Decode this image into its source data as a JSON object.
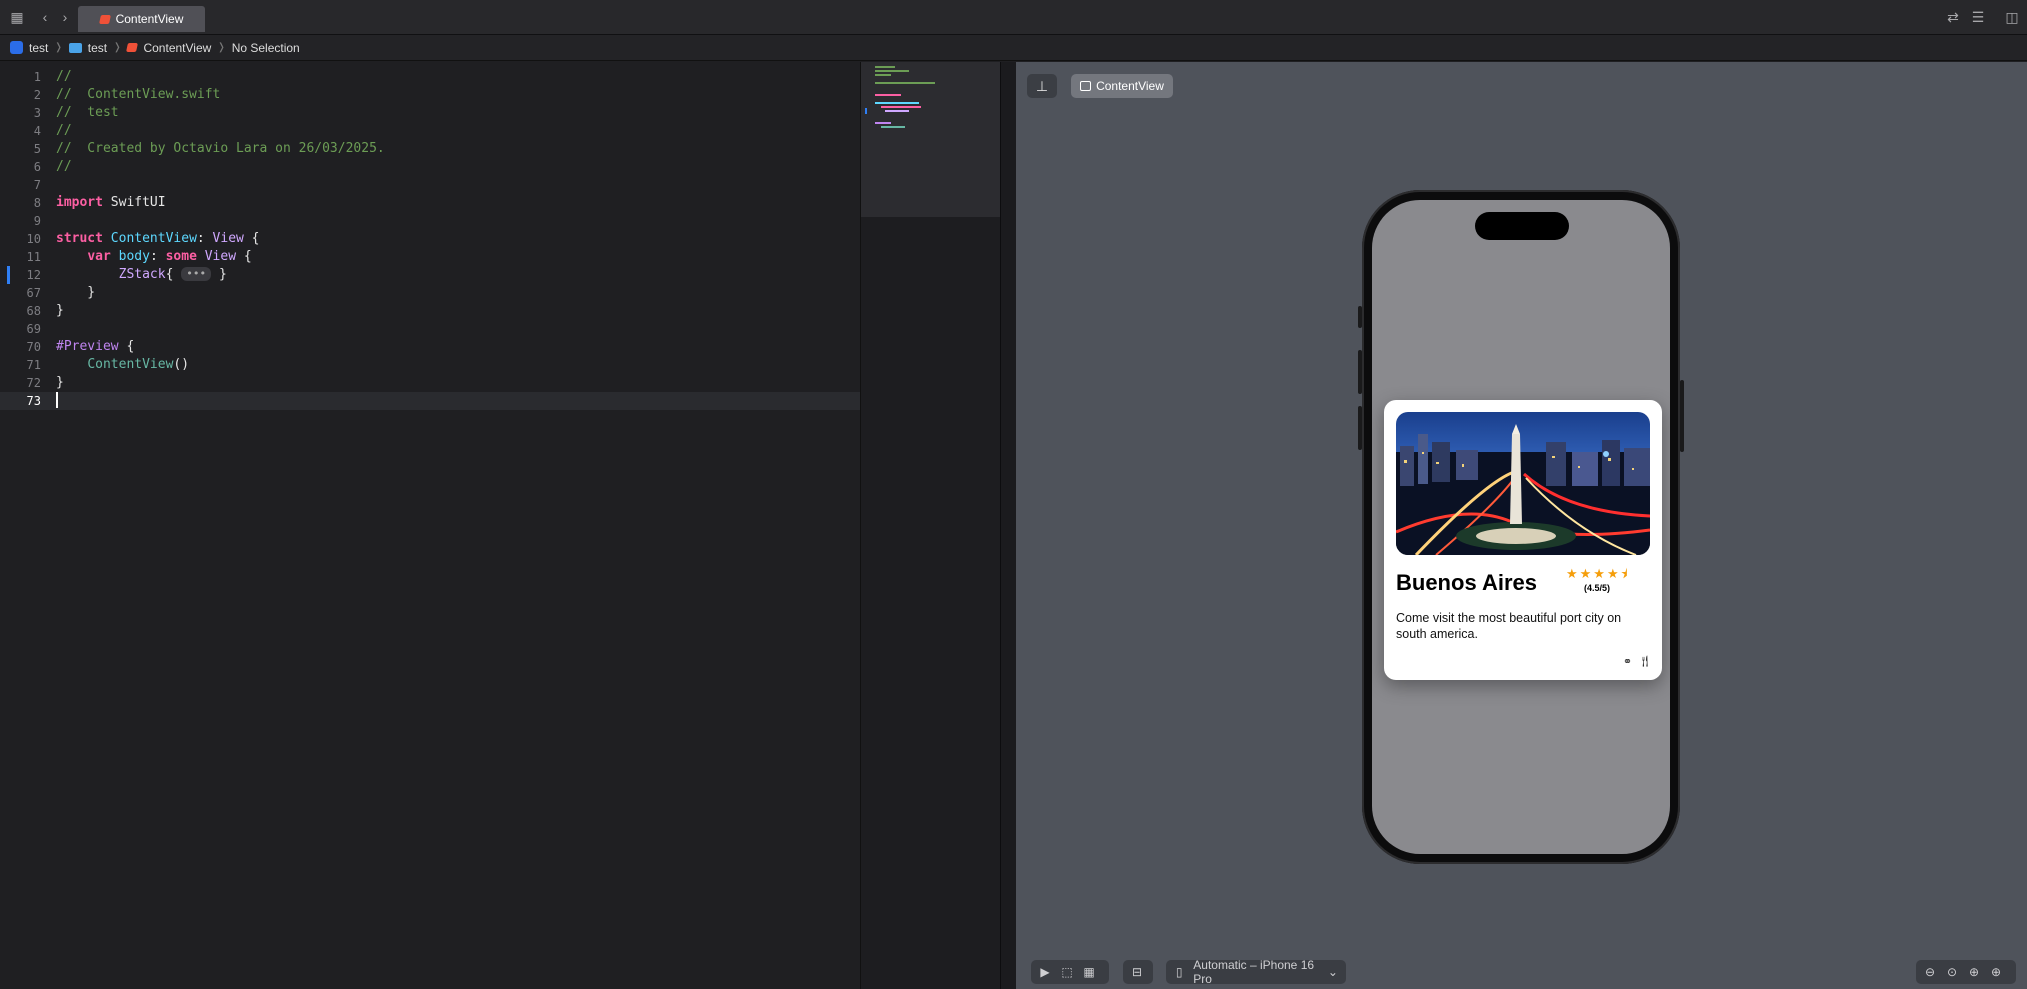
{
  "window": {
    "active_tab": "ContentView"
  },
  "breadcrumb": {
    "project": "test",
    "folder": "test",
    "file": "ContentView",
    "selection": "No Selection"
  },
  "editor": {
    "lines": [
      {
        "n": "1",
        "segments": [
          {
            "t": "//",
            "c": "comment"
          }
        ]
      },
      {
        "n": "2",
        "segments": [
          {
            "t": "//  ContentView.swift",
            "c": "comment"
          }
        ]
      },
      {
        "n": "3",
        "segments": [
          {
            "t": "//  test",
            "c": "comment"
          }
        ]
      },
      {
        "n": "4",
        "segments": [
          {
            "t": "//",
            "c": "comment"
          }
        ]
      },
      {
        "n": "5",
        "segments": [
          {
            "t": "//  Created by Octavio Lara on 26/03/2025.",
            "c": "comment"
          }
        ]
      },
      {
        "n": "6",
        "segments": [
          {
            "t": "//",
            "c": "comment"
          }
        ]
      },
      {
        "n": "7",
        "segments": []
      },
      {
        "n": "8",
        "segments": [
          {
            "t": "import",
            "c": "kw"
          },
          {
            "t": " SwiftUI",
            "c": "plain"
          }
        ]
      },
      {
        "n": "9",
        "segments": []
      },
      {
        "n": "10",
        "segments": [
          {
            "t": "struct",
            "c": "kw"
          },
          {
            "t": " ",
            "c": "plain"
          },
          {
            "t": "ContentView",
            "c": "type"
          },
          {
            "t": ": ",
            "c": "plain"
          },
          {
            "t": "View",
            "c": "type2"
          },
          {
            "t": " {",
            "c": "plain"
          }
        ]
      },
      {
        "n": "11",
        "segments": [
          {
            "t": "    ",
            "c": "plain"
          },
          {
            "t": "var",
            "c": "kw"
          },
          {
            "t": " ",
            "c": "plain"
          },
          {
            "t": "body",
            "c": "type"
          },
          {
            "t": ": ",
            "c": "plain"
          },
          {
            "t": "some",
            "c": "kw"
          },
          {
            "t": " ",
            "c": "plain"
          },
          {
            "t": "View",
            "c": "type2"
          },
          {
            "t": " {",
            "c": "plain"
          }
        ]
      },
      {
        "n": "12",
        "segments": [
          {
            "t": "        ",
            "c": "plain"
          },
          {
            "t": "ZStack",
            "c": "type2"
          },
          {
            "t": "{ ",
            "c": "plain"
          },
          {
            "t": "•••",
            "c": "badge"
          },
          {
            "t": " }",
            "c": "plain"
          }
        ]
      },
      {
        "n": "67",
        "segments": [
          {
            "t": "    }",
            "c": "plain"
          }
        ]
      },
      {
        "n": "68",
        "segments": [
          {
            "t": "}",
            "c": "plain"
          }
        ]
      },
      {
        "n": "69",
        "segments": []
      },
      {
        "n": "70",
        "segments": [
          {
            "t": "#Preview",
            "c": "attr"
          },
          {
            "t": " {",
            "c": "plain"
          }
        ]
      },
      {
        "n": "71",
        "segments": [
          {
            "t": "    ",
            "c": "plain"
          },
          {
            "t": "ContentView",
            "c": "fn"
          },
          {
            "t": "()",
            "c": "plain"
          }
        ]
      },
      {
        "n": "72",
        "segments": [
          {
            "t": "}",
            "c": "plain"
          }
        ]
      },
      {
        "n": "73",
        "segments": []
      }
    ],
    "current_line": "73"
  },
  "preview": {
    "chip_label": "ContentView",
    "card": {
      "title": "Buenos Aires",
      "stars": "★★★★⯨",
      "rating": "(4.5/5)",
      "description": "Come visit the most beautiful port city on south america."
    },
    "device_label": "Automatic – iPhone 16 Pro"
  },
  "colors": {
    "accent": "#2f7ff5",
    "star": "#f59e0b",
    "swift": "#f05138"
  }
}
